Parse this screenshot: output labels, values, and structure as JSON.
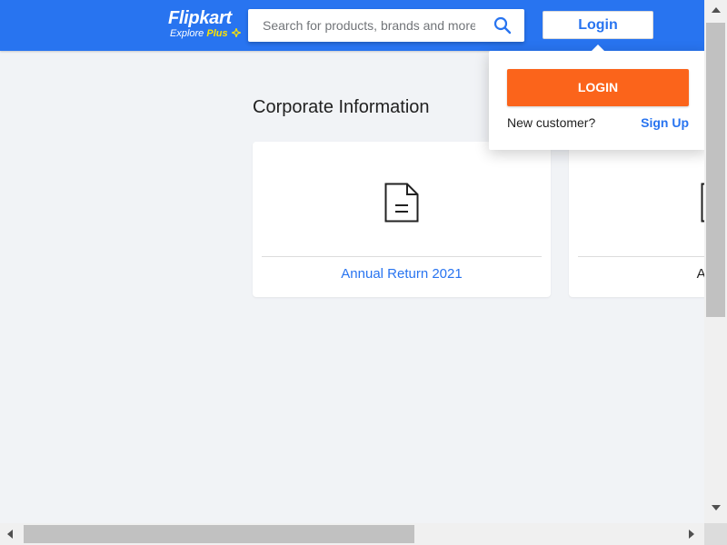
{
  "header": {
    "logo_text": "Flipkart",
    "logo_tagline": "Explore",
    "logo_plus": "Plus",
    "search_placeholder": "Search for products, brands and more",
    "search_icon": "search-icon",
    "login_label": "Login",
    "colors": {
      "background": "#2874f0",
      "plus_accent": "#ffe500"
    }
  },
  "login_dropdown": {
    "login_button_label": "LOGIN",
    "new_customer_label": "New customer?",
    "signup_label": "Sign Up",
    "colors": {
      "login_button": "#fb641b",
      "link": "#2874f0"
    }
  },
  "main": {
    "title": "Corporate Information",
    "cards": [
      {
        "label": "Annual Return 2021",
        "icon": "document-icon"
      },
      {
        "label": "Annual",
        "icon": "document-icon"
      }
    ]
  },
  "scrollbars": {
    "vertical_icon_up": "chevron-up-icon",
    "vertical_icon_down": "chevron-down-icon",
    "horizontal_icon_left": "chevron-left-icon",
    "horizontal_icon_right": "chevron-right-icon"
  }
}
